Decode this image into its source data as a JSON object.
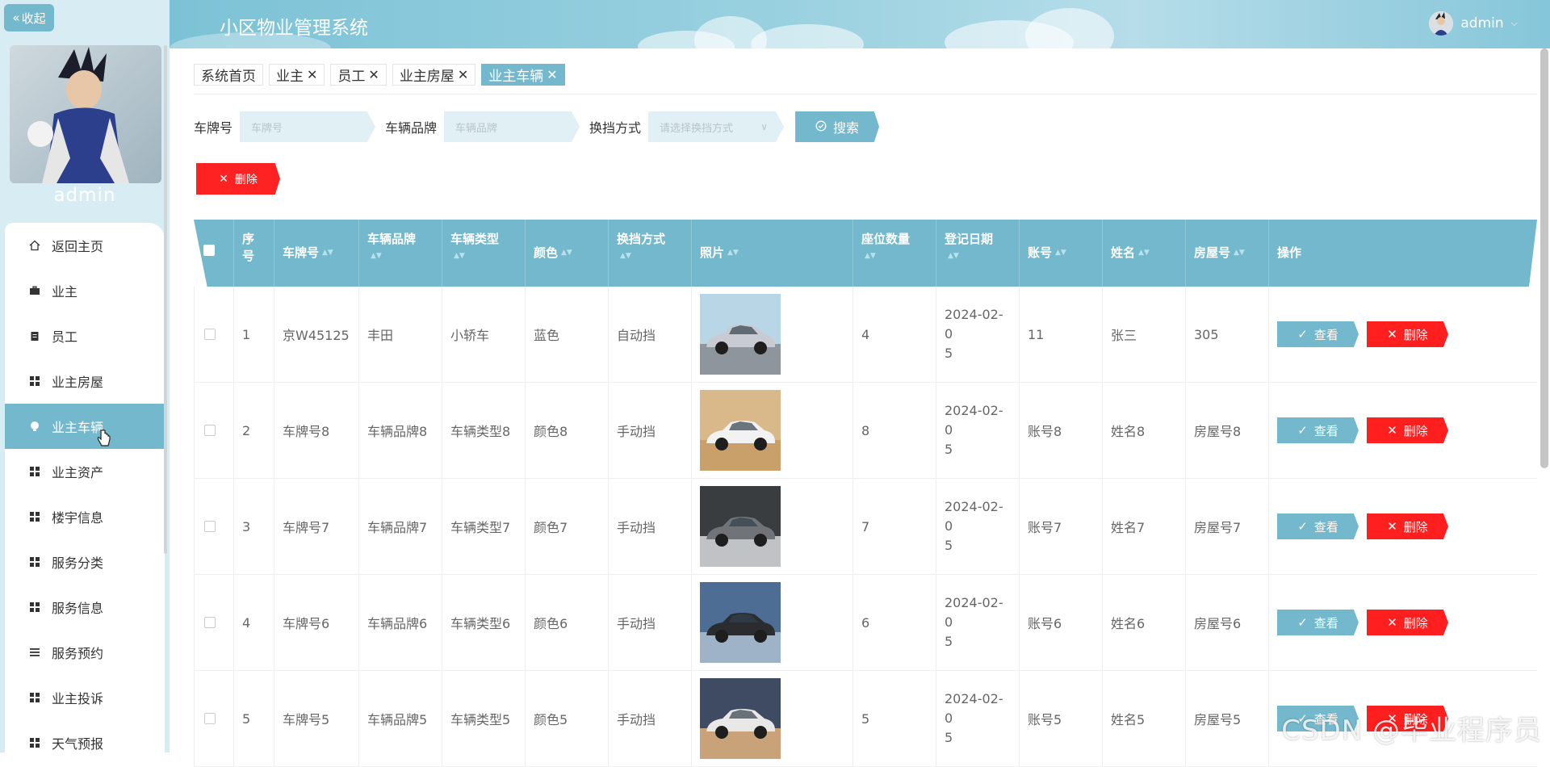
{
  "sidebar": {
    "collapse_label": "收起",
    "user_name": "admin",
    "menu": [
      {
        "label": "返回主页",
        "icon": "home-icon"
      },
      {
        "label": "业主",
        "icon": "briefcase-icon"
      },
      {
        "label": "员工",
        "icon": "clipboard-icon"
      },
      {
        "label": "业主房屋",
        "icon": "grid-icon"
      },
      {
        "label": "业主车辆",
        "icon": "bulb-icon",
        "active": true
      },
      {
        "label": "业主资产",
        "icon": "grid-icon"
      },
      {
        "label": "楼宇信息",
        "icon": "grid-icon"
      },
      {
        "label": "服务分类",
        "icon": "grid-icon"
      },
      {
        "label": "服务信息",
        "icon": "grid-icon"
      },
      {
        "label": "服务预约",
        "icon": "list-icon"
      },
      {
        "label": "业主投诉",
        "icon": "grid-icon"
      },
      {
        "label": "天气预报",
        "icon": "grid-icon"
      }
    ]
  },
  "header": {
    "title": "小区物业管理系统",
    "user": "admin"
  },
  "tabs": [
    {
      "label": "系统首页",
      "closable": false
    },
    {
      "label": "业主",
      "closable": true
    },
    {
      "label": "员工",
      "closable": true
    },
    {
      "label": "业主房屋",
      "closable": true
    },
    {
      "label": "业主车辆",
      "closable": true,
      "active": true
    }
  ],
  "search": {
    "plate_label": "车牌号",
    "plate_placeholder": "车牌号",
    "brand_label": "车辆品牌",
    "brand_placeholder": "车辆品牌",
    "gear_label": "换挡方式",
    "gear_placeholder": "请选择换挡方式",
    "search_button": "搜索",
    "delete_button": "删除"
  },
  "table": {
    "headers": [
      "序号",
      "车牌号",
      "车辆品牌",
      "车辆类型",
      "颜色",
      "换挡方式",
      "照片",
      "座位数量",
      "登记日期",
      "账号",
      "姓名",
      "房屋号",
      "操作"
    ],
    "view_label": "查看",
    "delete_label": "删除",
    "rows": [
      {
        "no": "1",
        "plate": "京W45125",
        "brand": "丰田",
        "type": "小轿车",
        "color": "蓝色",
        "gear": "自动挡",
        "seats": "4",
        "date1": "2024-02-0",
        "date2": "5",
        "account": "11",
        "name": "张三",
        "house": "305"
      },
      {
        "no": "2",
        "plate": "车牌号8",
        "brand": "车辆品牌8",
        "type": "车辆类型8",
        "color": "颜色8",
        "gear": "手动挡",
        "seats": "8",
        "date1": "2024-02-0",
        "date2": "5",
        "account": "账号8",
        "name": "姓名8",
        "house": "房屋号8"
      },
      {
        "no": "3",
        "plate": "车牌号7",
        "brand": "车辆品牌7",
        "type": "车辆类型7",
        "color": "颜色7",
        "gear": "手动挡",
        "seats": "7",
        "date1": "2024-02-0",
        "date2": "5",
        "account": "账号7",
        "name": "姓名7",
        "house": "房屋号7"
      },
      {
        "no": "4",
        "plate": "车牌号6",
        "brand": "车辆品牌6",
        "type": "车辆类型6",
        "color": "颜色6",
        "gear": "手动挡",
        "seats": "6",
        "date1": "2024-02-0",
        "date2": "5",
        "account": "账号6",
        "name": "姓名6",
        "house": "房屋号6"
      },
      {
        "no": "5",
        "plate": "车牌号5",
        "brand": "车辆品牌5",
        "type": "车辆类型5",
        "color": "颜色5",
        "gear": "手动挡",
        "seats": "5",
        "date1": "2024-02-0",
        "date2": "5",
        "account": "账号5",
        "name": "姓名5",
        "house": "房屋号5"
      }
    ]
  },
  "watermark": "CSDN @毕业程序员",
  "colors": {
    "accent": "#73b8cc",
    "danger": "#ff2222",
    "sidebar_bg": "#d7edf3"
  }
}
